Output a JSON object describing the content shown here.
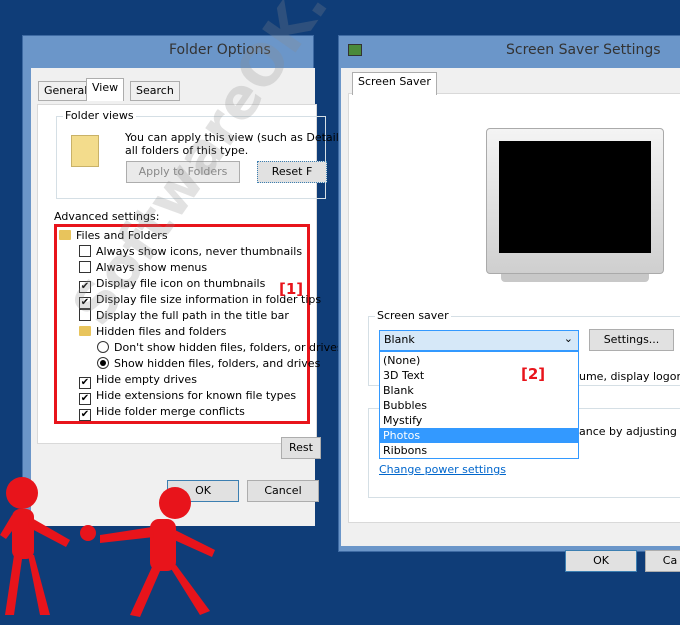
{
  "folder_options": {
    "title": "Folder Options",
    "tabs": [
      {
        "label": "General"
      },
      {
        "label": "View"
      },
      {
        "label": "Search"
      }
    ],
    "folder_views": {
      "label": "Folder views",
      "text1": "You can apply this view (such as Details",
      "text2": "all folders of this type.",
      "apply_label": "Apply to Folders",
      "reset_label": "Reset F"
    },
    "advanced_label": "Advanced settings:",
    "items": [
      {
        "label": "Files and Folders",
        "type": "folder"
      },
      {
        "label": "Always show icons, never thumbnails",
        "type": "checkbox",
        "checked": false
      },
      {
        "label": "Always show menus",
        "type": "checkbox",
        "checked": false
      },
      {
        "label": "Display file icon on thumbnails",
        "type": "checkbox",
        "checked": true
      },
      {
        "label": "Display file size information in folder tips",
        "type": "checkbox",
        "checked": true
      },
      {
        "label": "Display the full path in the title bar",
        "type": "checkbox",
        "checked": false
      },
      {
        "label": "Hidden files and folders",
        "type": "folder"
      },
      {
        "label": "Don't show hidden files, folders, or drives",
        "type": "radio",
        "checked": false
      },
      {
        "label": "Show hidden files, folders, and drives",
        "type": "radio",
        "checked": true
      },
      {
        "label": "Hide empty drives",
        "type": "checkbox",
        "checked": true
      },
      {
        "label": "Hide extensions for known file types",
        "type": "checkbox",
        "checked": true
      },
      {
        "label": "Hide folder merge conflicts",
        "type": "checkbox",
        "checked": true
      }
    ],
    "annotation": "[1]",
    "restore_label": "Rest",
    "ok_label": "OK",
    "cancel_label": "Cancel"
  },
  "screen_saver": {
    "title": "Screen Saver Settings",
    "tab": "Screen Saver",
    "group_label": "Screen saver",
    "selected": "Blank",
    "settings_label": "Settings...",
    "options": [
      "(None)",
      "3D Text",
      "Blank",
      "Bubbles",
      "Mystify",
      "Photos",
      "Ribbons"
    ],
    "highlighted": "Photos",
    "behind_text1": "ume, display logon",
    "behind_text2": "ance by adjusting",
    "power_link": "Change power settings",
    "annotation": "[2]",
    "ok_label": "OK",
    "cancel_label": "Ca"
  },
  "watermark": "SoftwareOK.com",
  "colors": {
    "background": "#0f3d78",
    "frame": "#6b96c9",
    "annotation": "#e8141b",
    "highlight": "#3399ff"
  }
}
